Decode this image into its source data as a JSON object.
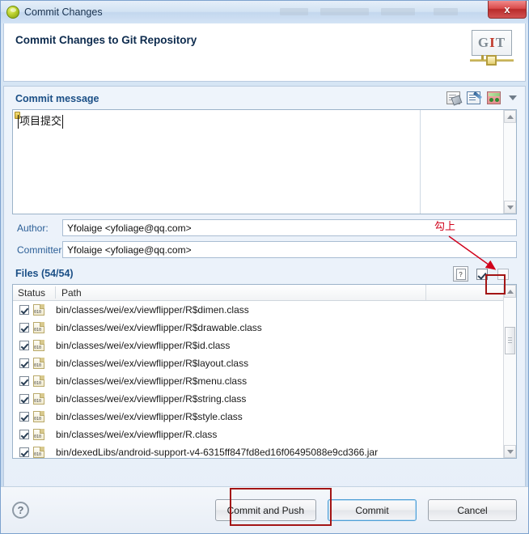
{
  "window": {
    "title": "Commit Changes",
    "title_icon": "git-commit-icon",
    "close_label": "x"
  },
  "header": {
    "title": "Commit Changes to Git Repository",
    "logo": {
      "g": "G",
      "i": "I",
      "t": "T"
    }
  },
  "commit_message": {
    "section_label": "Commit message",
    "value": "项目提交",
    "toolbar_icons": [
      "insert-signed-off-icon",
      "sign-commit-icon",
      "add-author-icon",
      "chevron-down-icon"
    ]
  },
  "fields": {
    "author_label": "Author:",
    "author_value": "Yfolaige <yfoliage@qq.com>",
    "committer_label": "Committer:",
    "committer_value": "Yfolaige <yfoliage@qq.com>"
  },
  "files": {
    "section_label": "Files (54/54)",
    "toolbar": {
      "help_label": "?",
      "select_all_label": "",
      "deselect_all_label": ""
    },
    "columns": [
      "Status",
      "Path"
    ],
    "rows": [
      {
        "checked": true,
        "path": "bin/classes/wei/ex/viewflipper/R$dimen.class"
      },
      {
        "checked": true,
        "path": "bin/classes/wei/ex/viewflipper/R$drawable.class"
      },
      {
        "checked": true,
        "path": "bin/classes/wei/ex/viewflipper/R$id.class"
      },
      {
        "checked": true,
        "path": "bin/classes/wei/ex/viewflipper/R$layout.class"
      },
      {
        "checked": true,
        "path": "bin/classes/wei/ex/viewflipper/R$menu.class"
      },
      {
        "checked": true,
        "path": "bin/classes/wei/ex/viewflipper/R$string.class"
      },
      {
        "checked": true,
        "path": "bin/classes/wei/ex/viewflipper/R$style.class"
      },
      {
        "checked": true,
        "path": "bin/classes/wei/ex/viewflipper/R.class"
      },
      {
        "checked": true,
        "path": "bin/dexedLibs/android-support-v4-6315ff847fd8ed16f06495088e9cd366.jar"
      }
    ]
  },
  "footer": {
    "help_label": "?",
    "commit_and_push_label": "Commit and Push",
    "commit_label": "Commit",
    "cancel_label": "Cancel"
  },
  "annotations": {
    "check_it_text": "勾上",
    "accent_color": "#d0021b",
    "box_color": "#a31515"
  }
}
